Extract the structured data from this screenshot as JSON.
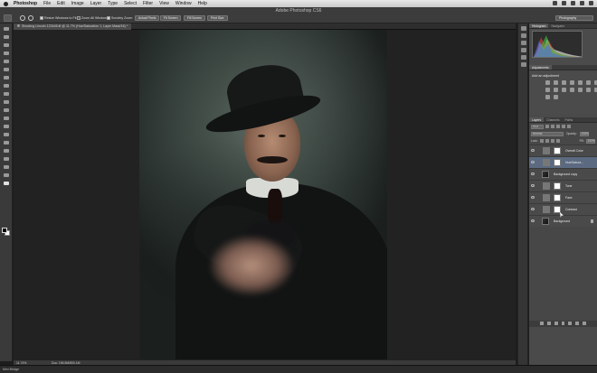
{
  "menubar": {
    "items": [
      "Photoshop",
      "File",
      "Edit",
      "Image",
      "Layer",
      "Type",
      "Select",
      "Filter",
      "View",
      "Window",
      "Help"
    ]
  },
  "optionsbar": {
    "app_title": "Adobe Photoshop CS6",
    "resize_windows_label": "Resize Windows to Fit",
    "zoom_all_windows_label": "Zoom All Windows",
    "scrubby_zoom_label": "Scrubby Zoom",
    "actual_pixels_label": "Actual Pixels",
    "fit_screen_label": "Fit Screen",
    "fill_screen_label": "Fill Screen",
    "print_size_label": "Print Size",
    "workspace_label": "Photography"
  },
  "document": {
    "tab_title": "Shooting Lincoln 123446.tif @ 11.7% (Hue/Saturation 1, Layer Mask/16) *"
  },
  "statusbar": {
    "zoom": "11.74%",
    "doc_info": "Doc: 196.5M/800.1M",
    "mini_bridge": "Mini Bridge"
  },
  "panels": {
    "histogram_tab": "Histogram",
    "navigator_tab": "Navigator",
    "adjustments_tab": "Adjustments",
    "add_adjustment": "Add an adjustment",
    "layers_tab": "Layers",
    "channels_tab": "Channels",
    "paths_tab": "Paths",
    "kind_label": "Kind",
    "blend_mode": "Normal",
    "opacity_label": "Opacity:",
    "opacity_value": "100%",
    "lock_label": "Lock:",
    "fill_label": "Fill:",
    "fill_value": "100%"
  },
  "layers": [
    {
      "name": "Overall Color",
      "type": "adjustment",
      "selected": false
    },
    {
      "name": "Hue/Satura...",
      "type": "adjustment",
      "selected": true
    },
    {
      "name": "Background copy",
      "type": "image",
      "selected": false
    },
    {
      "name": "Tone",
      "type": "adjustment",
      "selected": false
    },
    {
      "name": "Face",
      "type": "adjustment",
      "selected": false
    },
    {
      "name": "Contrast",
      "type": "adjustment",
      "selected": false
    },
    {
      "name": "Background",
      "type": "image",
      "selected": false
    }
  ],
  "colors": {
    "selected_layer": "#5b6a80",
    "panel_bg": "#4a4a4a",
    "canvas_bg": "#222222"
  }
}
